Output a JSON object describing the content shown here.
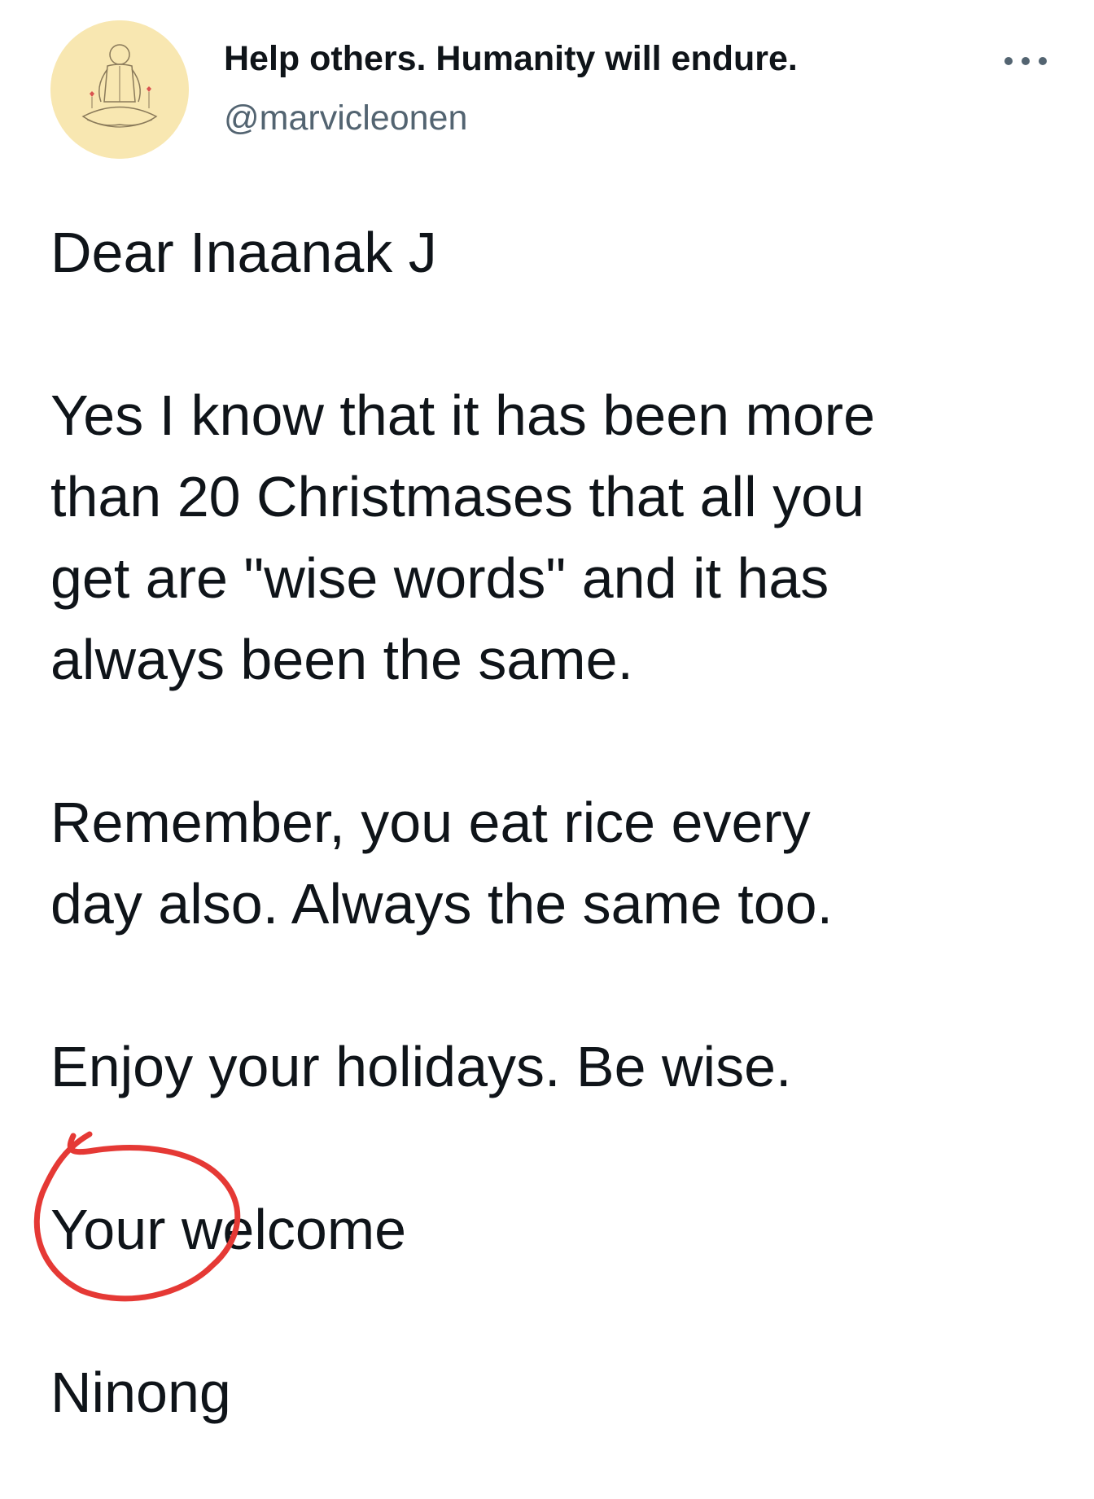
{
  "tweet": {
    "author": {
      "display_name": "Help others. Humanity will endure.",
      "handle": "@marvicleonen",
      "avatar_icon": "meditating-figure-avatar"
    },
    "more_icon": "more-horizontal-icon",
    "body": {
      "greeting": "Dear Inaanak J",
      "paragraph1": [
        "Yes I know that it has been more",
        "than 20 Christmases that all you",
        "get are \"wise words\" and it has",
        "always been the same."
      ],
      "paragraph2": [
        "Remember, you eat rice every",
        "day also.  Always the same too."
      ],
      "paragraph3": "Enjoy your holidays. Be wise.",
      "paragraph4": "Your welcome",
      "signature": "Ninong"
    },
    "annotation": {
      "type": "red-circle-highlight",
      "color": "#e53935"
    },
    "colors": {
      "text": "#0f1419",
      "secondary": "#536471",
      "avatar_bg": "#f8e7b1",
      "annotation": "#e53935"
    }
  }
}
